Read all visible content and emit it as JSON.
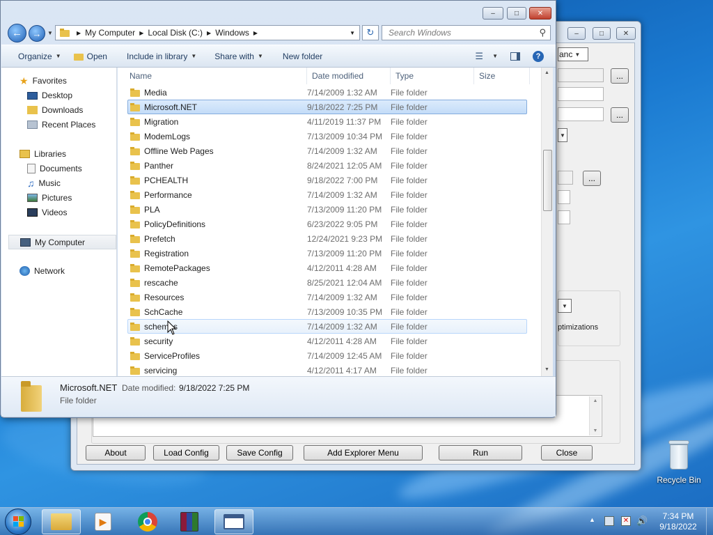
{
  "dialog": {
    "breadcrumb": [
      "My Computer",
      "Local Disk (C:)",
      "Windows"
    ],
    "search_placeholder": "Search Windows"
  },
  "toolbar": {
    "organize": "Organize",
    "open": "Open",
    "include_in_library": "Include in library",
    "share_with": "Share with",
    "new_folder": "New folder"
  },
  "nav": {
    "favorites": "Favorites",
    "desktop": "Desktop",
    "downloads": "Downloads",
    "recent_places": "Recent Places",
    "libraries": "Libraries",
    "documents": "Documents",
    "music": "Music",
    "pictures": "Pictures",
    "videos": "Videos",
    "my_computer": "My Computer",
    "network": "Network"
  },
  "columns": {
    "name": "Name",
    "date": "Date modified",
    "type": "Type",
    "size": "Size"
  },
  "rows": [
    {
      "name": "Media",
      "date": "7/14/2009 1:32 AM",
      "type": "File folder"
    },
    {
      "name": "Microsoft.NET",
      "date": "9/18/2022 7:25 PM",
      "type": "File folder"
    },
    {
      "name": "Migration",
      "date": "4/11/2019 11:37 PM",
      "type": "File folder"
    },
    {
      "name": "ModemLogs",
      "date": "7/13/2009 10:34 PM",
      "type": "File folder"
    },
    {
      "name": "Offline Web Pages",
      "date": "7/14/2009 1:32 AM",
      "type": "File folder"
    },
    {
      "name": "Panther",
      "date": "8/24/2021 12:05 AM",
      "type": "File folder"
    },
    {
      "name": "PCHEALTH",
      "date": "9/18/2022 7:00 PM",
      "type": "File folder"
    },
    {
      "name": "Performance",
      "date": "7/14/2009 1:32 AM",
      "type": "File folder"
    },
    {
      "name": "PLA",
      "date": "7/13/2009 11:20 PM",
      "type": "File folder"
    },
    {
      "name": "PolicyDefinitions",
      "date": "6/23/2022 9:05 PM",
      "type": "File folder"
    },
    {
      "name": "Prefetch",
      "date": "12/24/2021 9:23 PM",
      "type": "File folder"
    },
    {
      "name": "Registration",
      "date": "7/13/2009 11:20 PM",
      "type": "File folder"
    },
    {
      "name": "RemotePackages",
      "date": "4/12/2011 4:28 AM",
      "type": "File folder"
    },
    {
      "name": "rescache",
      "date": "8/25/2021 12:04 AM",
      "type": "File folder"
    },
    {
      "name": "Resources",
      "date": "7/14/2009 1:32 AM",
      "type": "File folder"
    },
    {
      "name": "SchCache",
      "date": "7/13/2009 10:35 PM",
      "type": "File folder"
    },
    {
      "name": "schemas",
      "date": "7/14/2009 1:32 AM",
      "type": "File folder"
    },
    {
      "name": "security",
      "date": "4/12/2011 4:28 AM",
      "type": "File folder"
    },
    {
      "name": "ServiceProfiles",
      "date": "7/14/2009 12:45 AM",
      "type": "File folder"
    },
    {
      "name": "servicing",
      "date": "4/12/2011 4:17 AM",
      "type": "File folder"
    }
  ],
  "selected_row": "Microsoft.NET",
  "details": {
    "name": "Microsoft.NET",
    "date_label": "Date modified:",
    "date_value": "9/18/2022 7:25 PM",
    "type": "File folder"
  },
  "background_app": {
    "combo_text": "anc",
    "option_text": "ptimizations",
    "buttons": {
      "about": "About",
      "load_config": "Load Config",
      "save_config": "Save Config",
      "add_explorer_menu": "Add Explorer Menu",
      "run": "Run",
      "close": "Close"
    }
  },
  "desktop": {
    "recycle_bin": "Recycle Bin"
  },
  "clock": {
    "time": "7:34 PM",
    "date": "9/18/2022"
  }
}
